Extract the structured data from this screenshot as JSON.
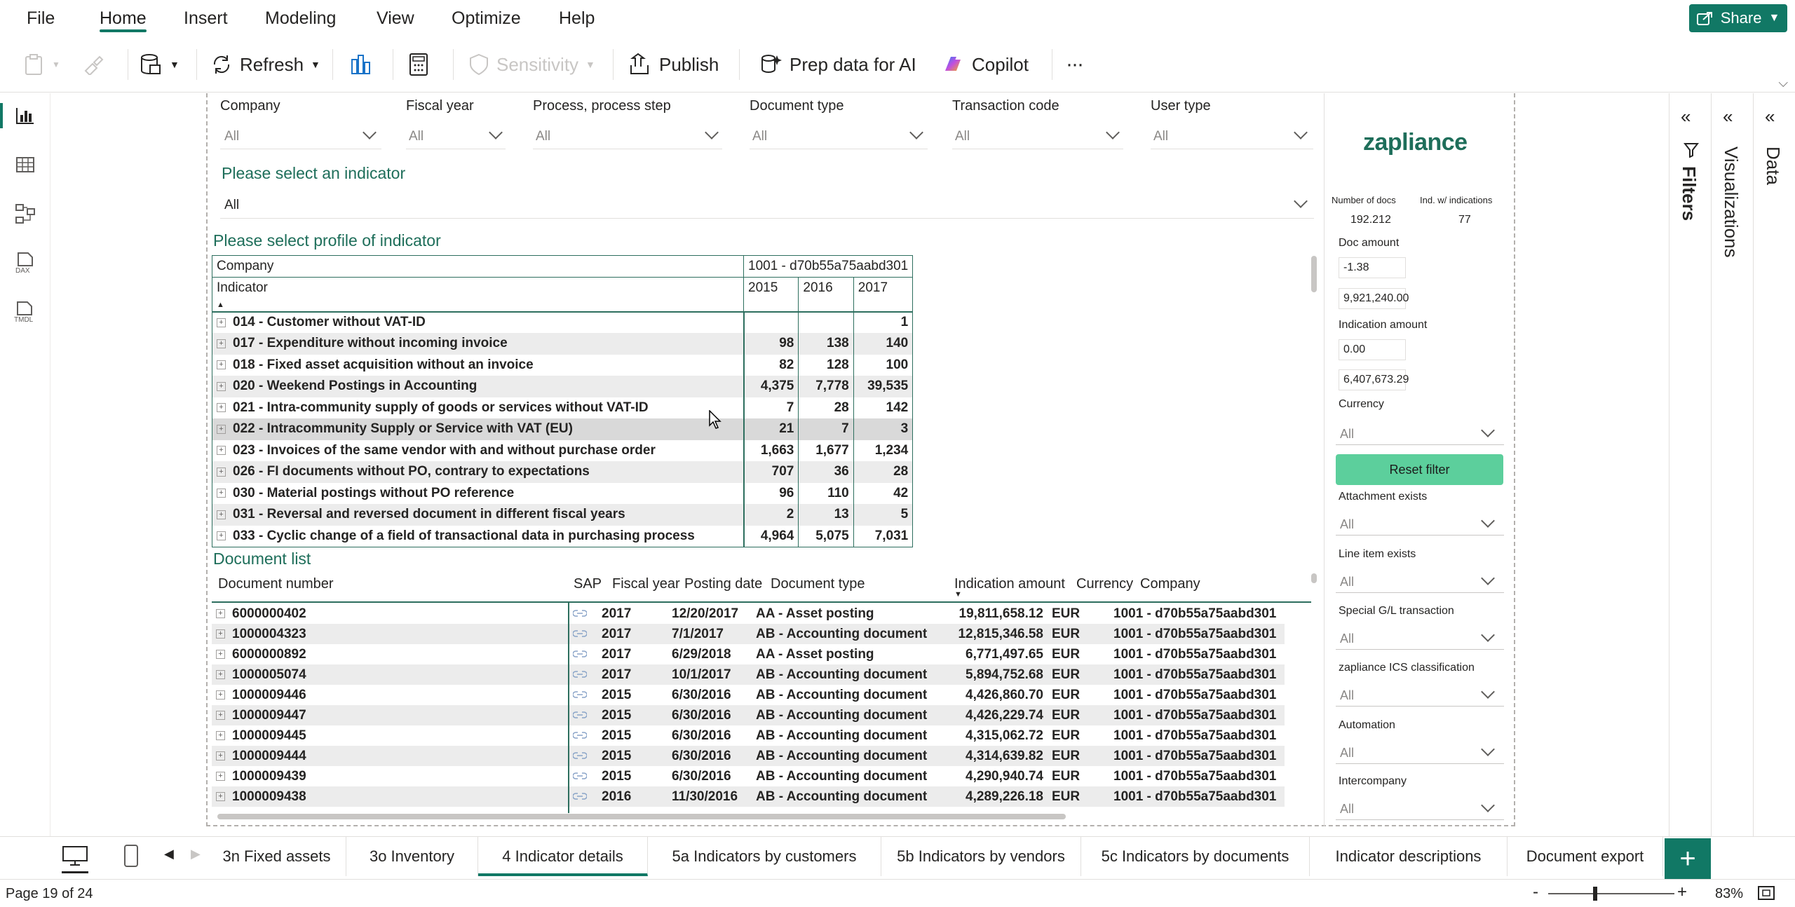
{
  "menu": {
    "items": [
      "File",
      "Home",
      "Insert",
      "Modeling",
      "View",
      "Optimize",
      "Help"
    ],
    "active": "Home",
    "share": "Share"
  },
  "ribbon": {
    "refresh": "Refresh",
    "sensitivity": "Sensitivity",
    "publish": "Publish",
    "prep_ai": "Prep data for AI",
    "copilot": "Copilot",
    "more": "···"
  },
  "slicers": [
    {
      "label": "Company",
      "value": "All"
    },
    {
      "label": "Fiscal year",
      "value": "All"
    },
    {
      "label": "Process, process step",
      "value": "All"
    },
    {
      "label": "Document type",
      "value": "All"
    },
    {
      "label": "Transaction code",
      "value": "All"
    },
    {
      "label": "User type",
      "value": "All"
    }
  ],
  "indicator_select": {
    "title": "Please select an indicator",
    "value": "All"
  },
  "profile": {
    "title": "Please select profile of indicator",
    "company_label": "Company",
    "company_value": "1001 - d70b55a75aabd301",
    "indicator_label": "Indicator",
    "years": [
      "2015",
      "2016",
      "2017"
    ],
    "rows": [
      {
        "name": "014 - Customer without VAT-ID",
        "v": [
          "",
          "",
          "1"
        ]
      },
      {
        "name": "017 - Expenditure without incoming invoice",
        "v": [
          "98",
          "138",
          "140"
        ]
      },
      {
        "name": "018 - Fixed asset acquisition without an invoice",
        "v": [
          "82",
          "128",
          "100"
        ]
      },
      {
        "name": "020 - Weekend Postings in Accounting",
        "v": [
          "4,375",
          "7,778",
          "39,535"
        ]
      },
      {
        "name": "021 - Intra-community supply of goods or services without VAT-ID",
        "v": [
          "7",
          "28",
          "142"
        ]
      },
      {
        "name": "022 - Intracommunity Supply or Service with VAT (EU)",
        "v": [
          "21",
          "7",
          "3"
        ]
      },
      {
        "name": "023 - Invoices of the same vendor with and without purchase order",
        "v": [
          "1,663",
          "1,677",
          "1,234"
        ]
      },
      {
        "name": "026 - FI documents without PO, contrary to expectations",
        "v": [
          "707",
          "36",
          "28"
        ]
      },
      {
        "name": "030 - Material postings without PO reference",
        "v": [
          "96",
          "110",
          "42"
        ]
      },
      {
        "name": "031 - Reversal and reversed document in different fiscal years",
        "v": [
          "2",
          "13",
          "5"
        ]
      },
      {
        "name": "033 - Cyclic change of a field of transactional data in purchasing process",
        "v": [
          "4,964",
          "5,075",
          "7,031"
        ]
      }
    ]
  },
  "doclist": {
    "title": "Document list",
    "headers": [
      "Document number",
      "SAP",
      "Fiscal year",
      "Posting date",
      "Document type",
      "Indication amount",
      "Currency",
      "Company"
    ],
    "rows": [
      [
        "6000000402",
        "2017",
        "12/20/2017",
        "AA - Asset posting",
        "19,811,658.12",
        "EUR",
        "1001 - d70b55a75aabd301"
      ],
      [
        "1000004323",
        "2017",
        "7/1/2017",
        "AB - Accounting document",
        "12,815,346.58",
        "EUR",
        "1001 - d70b55a75aabd301"
      ],
      [
        "6000000892",
        "2017",
        "6/29/2018",
        "AA - Asset posting",
        "6,771,497.65",
        "EUR",
        "1001 - d70b55a75aabd301"
      ],
      [
        "1000005074",
        "2017",
        "10/1/2017",
        "AB - Accounting document",
        "5,894,752.68",
        "EUR",
        "1001 - d70b55a75aabd301"
      ],
      [
        "1000009446",
        "2015",
        "6/30/2016",
        "AB - Accounting document",
        "4,426,860.70",
        "EUR",
        "1001 - d70b55a75aabd301"
      ],
      [
        "1000009447",
        "2015",
        "6/30/2016",
        "AB - Accounting document",
        "4,426,229.74",
        "EUR",
        "1001 - d70b55a75aabd301"
      ],
      [
        "1000009445",
        "2015",
        "6/30/2016",
        "AB - Accounting document",
        "4,315,062.72",
        "EUR",
        "1001 - d70b55a75aabd301"
      ],
      [
        "1000009444",
        "2015",
        "6/30/2016",
        "AB - Accounting document",
        "4,314,639.82",
        "EUR",
        "1001 - d70b55a75aabd301"
      ],
      [
        "1000009439",
        "2015",
        "6/30/2016",
        "AB - Accounting document",
        "4,290,940.74",
        "EUR",
        "1001 - d70b55a75aabd301"
      ],
      [
        "1000009438",
        "2016",
        "11/30/2016",
        "AB - Accounting document",
        "4,289,226.18",
        "EUR",
        "1001 - d70b55a75aabd301"
      ]
    ]
  },
  "side_visual": {
    "logo": "zapliance",
    "num_docs_label": "Number of docs",
    "num_docs": "192.212",
    "ind_w_label": "Ind. w/ indications",
    "ind_w": "77",
    "doc_amount_label": "Doc amount",
    "doc_amount_min": "-1.38",
    "doc_amount_max": "9,921,240.00",
    "ind_amount_label": "Indication amount",
    "ind_amount_min": "0.00",
    "ind_amount_max": "6,407,673.29",
    "currency_label": "Currency",
    "currency_value": "All",
    "reset": "Reset filter",
    "filters": [
      {
        "label": "Attachment exists",
        "value": "All"
      },
      {
        "label": "Line item exists",
        "value": "All"
      },
      {
        "label": "Special G/L transaction",
        "value": "All"
      },
      {
        "label": "zapliance ICS classification",
        "value": "All"
      },
      {
        "label": "Automation",
        "value": "All"
      },
      {
        "label": "Intercompany",
        "value": "All"
      }
    ]
  },
  "panes": {
    "filters": "Filters",
    "visualizations": "Visualizations",
    "data": "Data"
  },
  "tabs": [
    "3n Fixed assets",
    "3o Inventory",
    "4 Indicator details",
    "5a Indicators by customers",
    "5b Indicators by vendors",
    "5c Indicators by documents",
    "Indicator descriptions",
    "Document export"
  ],
  "active_tab": "4 Indicator details",
  "status": {
    "page": "Page 19 of 24",
    "zoom": "83%"
  },
  "colors": {
    "accent": "#117865",
    "reset": "#5ccf9c",
    "title": "#1e6e5a"
  }
}
